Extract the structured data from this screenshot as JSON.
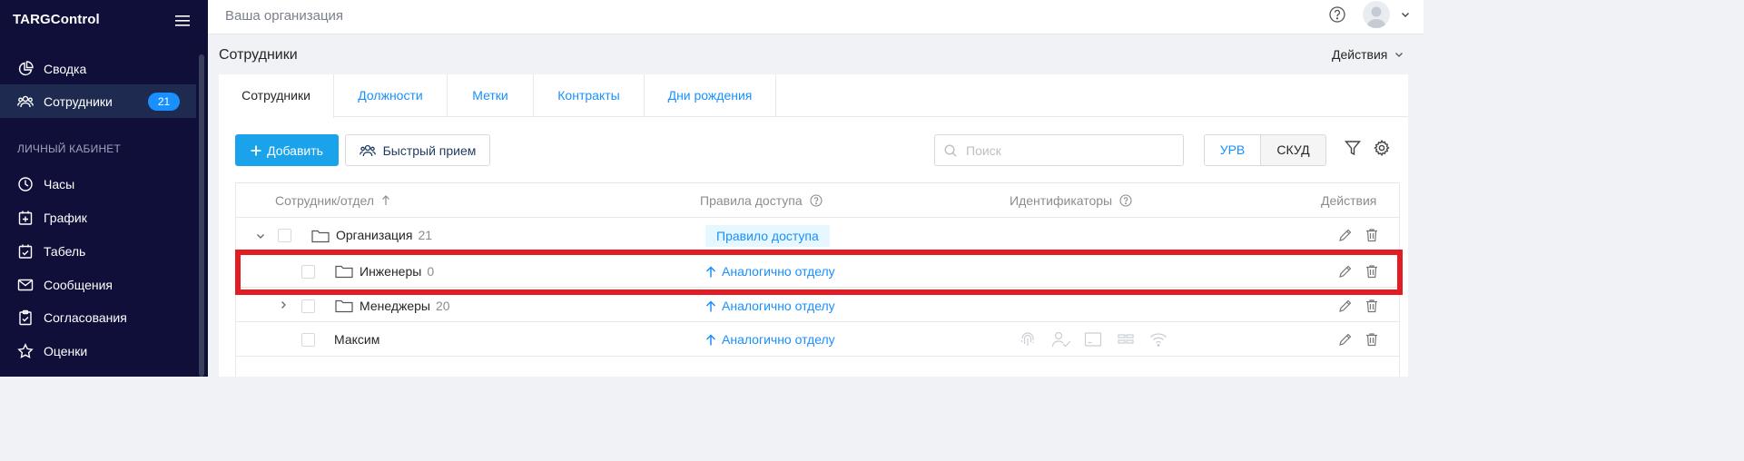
{
  "app": {
    "brand": "TARGControl"
  },
  "sidebar": {
    "items": [
      {
        "label": "Сводка",
        "icon": "pie-chart-icon"
      },
      {
        "label": "Сотрудники",
        "icon": "users-icon",
        "badge": "21",
        "active": true
      }
    ],
    "section_title": "ЛИЧНЫЙ КАБИНЕТ",
    "cabinet_items": [
      {
        "label": "Часы",
        "icon": "clock-icon"
      },
      {
        "label": "График",
        "icon": "calendar-plus-icon"
      },
      {
        "label": "Табель",
        "icon": "calendar-check-icon"
      },
      {
        "label": "Сообщения",
        "icon": "mail-icon"
      },
      {
        "label": "Согласования",
        "icon": "clipboard-check-icon"
      },
      {
        "label": "Оценки",
        "icon": "star-icon"
      }
    ]
  },
  "topbar": {
    "org_name": "Ваша организация"
  },
  "page": {
    "title": "Сотрудники",
    "actions_label": "Действия"
  },
  "tabs": [
    {
      "label": "Сотрудники",
      "active": true
    },
    {
      "label": "Должности"
    },
    {
      "label": "Метки"
    },
    {
      "label": "Контракты"
    },
    {
      "label": "Дни рождения"
    }
  ],
  "toolbar": {
    "add_label": "Добавить",
    "quick_label": "Быстрый прием",
    "search_placeholder": "Поиск",
    "seg_urv": "УРВ",
    "seg_skud": "СКУД"
  },
  "table": {
    "headers": {
      "employee": "Сотрудник/отдел",
      "access": "Правила доступа",
      "identifiers": "Идентификаторы",
      "actions": "Действия"
    },
    "rows": [
      {
        "name": "Организация",
        "count": "21",
        "access": "Правило доступа",
        "type": "org",
        "expanded": true
      },
      {
        "name": "Инженеры",
        "count": "0",
        "access": "Аналогично отделу",
        "type": "dept"
      },
      {
        "name": "Менеджеры",
        "count": "20",
        "access": "Аналогично отделу",
        "type": "dept",
        "expanded": false
      },
      {
        "name": "Максим",
        "access": "Аналогично отделу",
        "type": "employee",
        "identifier_icons": [
          "fingerprint-icon",
          "face-id-icon",
          "card-icon",
          "barcode-icon",
          "wifi-icon"
        ]
      }
    ]
  },
  "colors": {
    "accent": "#1890ff",
    "sidebar_bg": "#0f0f3a",
    "primary_button": "#1aa3ea",
    "highlight": "#e31b23"
  }
}
